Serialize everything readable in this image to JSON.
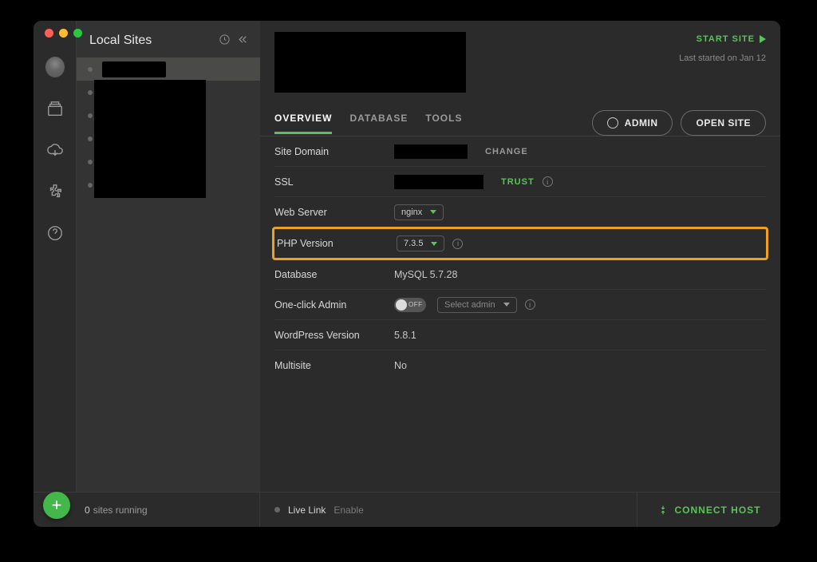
{
  "sidebar": {
    "title": "Local Sites",
    "sites_count": 6
  },
  "header": {
    "start_label": "START SITE",
    "last_started": "Last started on Jan 12"
  },
  "tabs": {
    "overview": "OVERVIEW",
    "database": "DATABASE",
    "tools": "TOOLS"
  },
  "actions": {
    "admin": "ADMIN",
    "open_site": "OPEN SITE"
  },
  "overview": {
    "site_domain_label": "Site Domain",
    "site_domain_action": "CHANGE",
    "ssl_label": "SSL",
    "ssl_action": "TRUST",
    "web_server_label": "Web Server",
    "web_server_value": "nginx",
    "php_label": "PHP Version",
    "php_value": "7.3.5",
    "database_label": "Database",
    "database_value": "MySQL 5.7.28",
    "oneclick_label": "One-click Admin",
    "oneclick_toggle": "OFF",
    "oneclick_select": "Select admin",
    "wp_label": "WordPress Version",
    "wp_value": "5.8.1",
    "multisite_label": "Multisite",
    "multisite_value": "No"
  },
  "footer": {
    "running_count": "0",
    "running_label": "sites running",
    "live_link": "Live Link",
    "enable": "Enable",
    "connect": "CONNECT HOST"
  }
}
